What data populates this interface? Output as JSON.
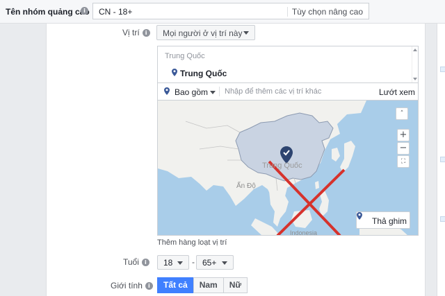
{
  "header": {
    "adset_name_label": "Tên nhóm quảng cáo",
    "adset_name_value": "CN - 18+",
    "advanced_options_link": "Tùy chọn nâng cao"
  },
  "location": {
    "label": "Vị trí",
    "audience_select": "Mọi người ở vị trí này",
    "group_title": "Trung Quốc",
    "selected_item": "Trung Quốc",
    "include_label": "Bao gồm",
    "search_placeholder": "Nhập để thêm các vị trí khác",
    "browse_link": "Lướt xem",
    "bulk_add_link": "Thêm hàng loạt vị trí"
  },
  "map": {
    "labels": {
      "pin_region": "Trung Quốc",
      "india": "Ấn Độ",
      "indonesia": "Indonesia"
    },
    "controls": {
      "collapse": "˄",
      "zoom_in": "+",
      "zoom_out": "−",
      "fit": "⛶"
    },
    "drop_pin_button": "Thả ghim",
    "colors": {
      "water": "#a9cde9",
      "land": "#f1f1ee",
      "selected_region": "#c9d3e2",
      "pin": "#2d4470",
      "overlay_cross": "#d6322c"
    }
  },
  "age": {
    "label": "Tuổi",
    "min": "18",
    "separator": "-",
    "max": "65+"
  },
  "gender": {
    "label": "Giới tính",
    "options": [
      "Tất cả",
      "Nam",
      "Nữ"
    ],
    "selected": "Tất cả"
  }
}
